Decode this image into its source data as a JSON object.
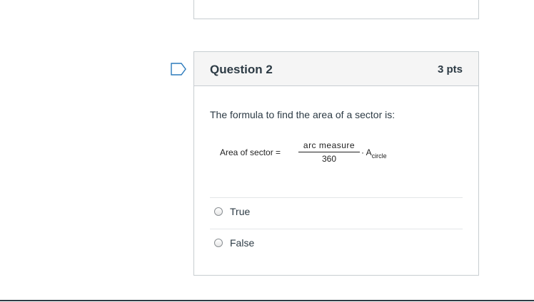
{
  "question": {
    "title": "Question 2",
    "points": "3 pts",
    "prompt": "The formula to find the area of a sector is:",
    "formula": {
      "lhs": "Area of sector =",
      "numerator": "arc measure",
      "denominator": "360",
      "rhs_symbol": "A",
      "rhs_subscript": "circle"
    },
    "answers": [
      {
        "label": "True"
      },
      {
        "label": "False"
      }
    ]
  }
}
